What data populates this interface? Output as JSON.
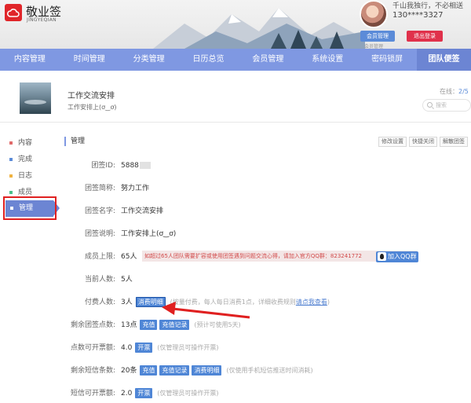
{
  "header": {
    "app_title": "敬业签",
    "app_subtitle": "JINGYEQIAN",
    "user_motto": "千山我独行，不必相送",
    "user_phone": "130****3327",
    "member_button": "会员管理",
    "logout_button": "退出登录",
    "member_faint": "会员管理"
  },
  "nav": {
    "items": [
      "内容管理",
      "时间管理",
      "分类管理",
      "日历总览",
      "会员管理",
      "系统设置",
      "密码锁屏",
      "团队便签"
    ],
    "active_index": 7
  },
  "team": {
    "name": "工作交流安排",
    "desc": "工作安排上(ơ‿ơ)",
    "online_label": "在线：",
    "online_value": "2/5",
    "search_placeholder": "搜索"
  },
  "sidebar": {
    "items": [
      {
        "label": "内容",
        "dot_color": "#e06a6a"
      },
      {
        "label": "完成",
        "dot_color": "#5b8bd8"
      },
      {
        "label": "日志",
        "dot_color": "#f0b341"
      },
      {
        "label": "成员",
        "dot_color": "#4cbf8a"
      },
      {
        "label": "管理",
        "dot_color": "#ffffff"
      }
    ],
    "active_index": 4
  },
  "section": {
    "title": "管理",
    "buttons": [
      "修改设置",
      "快捷关闭",
      "解散团签"
    ]
  },
  "fields": {
    "team_id": {
      "label": "团签ID:",
      "value": "5888"
    },
    "short_name": {
      "label": "团签简称:",
      "value": "努力工作"
    },
    "full_name": {
      "label": "团签名字:",
      "value": "工作交流安排"
    },
    "description": {
      "label": "团签说明:",
      "value": "工作安排上(ơ‿ơ)"
    },
    "member_limit": {
      "label": "成员上限:",
      "value": "65人",
      "notice": "如超过65人团队需要扩容或使用团签遇到问题交流心得，请加入官方QQ群：823241772",
      "qq_button": "加入QQ群"
    },
    "current_count": {
      "label": "当前人数:",
      "value": "5人"
    },
    "paid_count": {
      "label": "付费人数:",
      "value": "3人",
      "detail_button": "消费明细",
      "note": "(按量付费，每人每日消费1点，详细收费规则",
      "note_link": "请点我查看",
      "note_end": ")"
    },
    "remaining_points": {
      "label": "剩余团签点数:",
      "value": "13点",
      "recharge": "充值",
      "records": "充值记录",
      "note": "(预计可使用5天)"
    },
    "invoice_points": {
      "label": "点数可开票额:",
      "value": "4.0",
      "action": "开票",
      "note": "(仅管理员可操作开票)"
    },
    "sms": {
      "label": "剩余短信条数:",
      "value": "20条",
      "recharge": "充值",
      "records": "充值记录",
      "details": "消费明细",
      "note": "(仅使用手机短信推送时间消耗)"
    },
    "sms_invoice": {
      "label": "短信可开票额:",
      "value": "2.0",
      "action": "开票",
      "note": "(仅管理员可操作开票)"
    }
  },
  "colors": {
    "nav_bg": "#7f98e2",
    "accent": "#4f86d6",
    "logout": "#e0314b",
    "highlight_frame": "#e02020",
    "arrow": "#e02020"
  }
}
